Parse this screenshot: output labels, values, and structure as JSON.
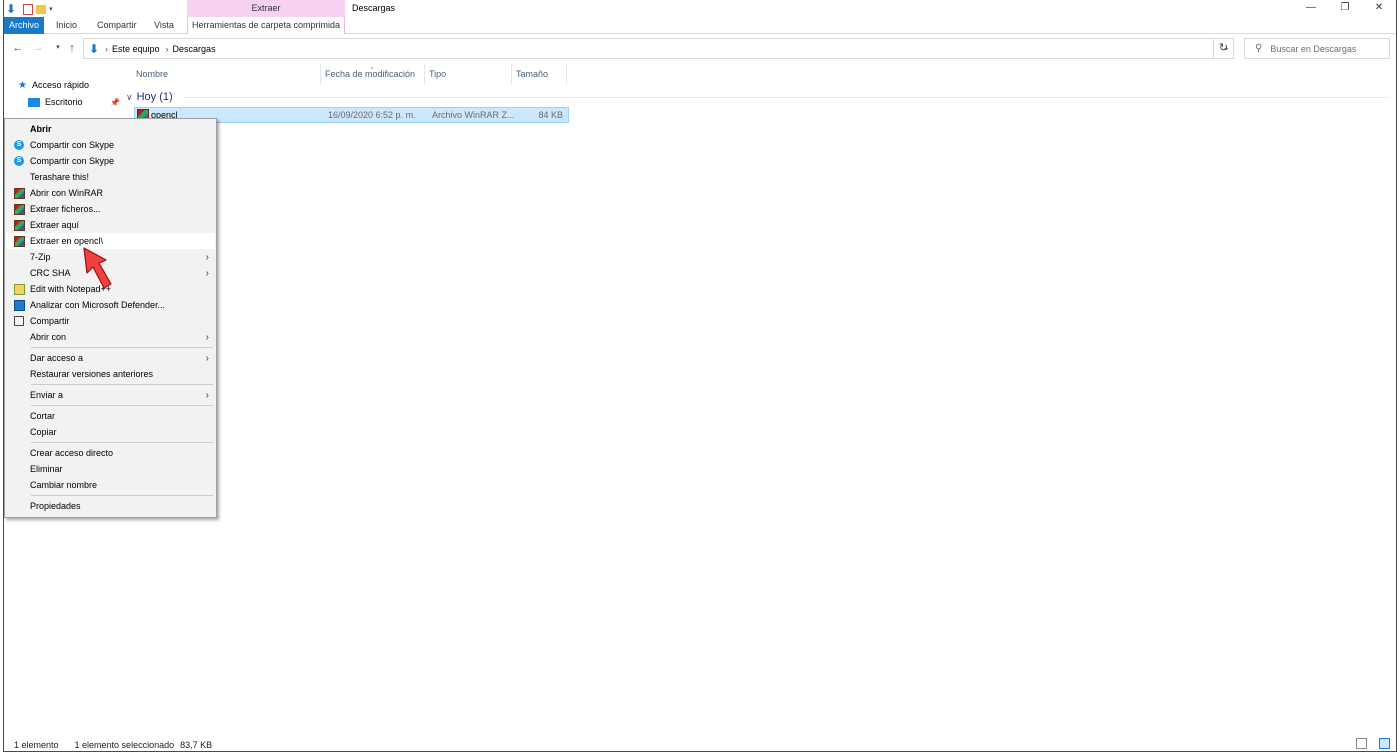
{
  "window": {
    "title": "Descargas",
    "context_tab_group": "Extraer",
    "controls": {
      "minimize": "—",
      "restore": "❐",
      "close": "✕"
    }
  },
  "ribbon": {
    "tabs": [
      "Archivo",
      "Inicio",
      "Compartir",
      "Vista",
      "Herramientas de carpeta comprimida"
    ]
  },
  "address": {
    "crumbs": [
      "Este equipo",
      "Descargas"
    ],
    "search_placeholder": "Buscar en Descargas"
  },
  "navpane": {
    "quick_access": "Acceso rápido",
    "escritorio": "Escritorio"
  },
  "columns": {
    "name": "Nombre",
    "date": "Fecha de modificación",
    "type": "Tipo",
    "size": "Tamaño"
  },
  "group": {
    "label": "Hoy (1)"
  },
  "file": {
    "name": "opencl",
    "date": "16/09/2020 6:52 p. m.",
    "type": "Archivo WinRAR Z...",
    "size": "84 KB"
  },
  "context_menu": {
    "items": [
      {
        "label": "Abrir",
        "icon": "none"
      },
      {
        "label": "Compartir con Skype",
        "icon": "skype-icon"
      },
      {
        "label": "Compartir con Skype",
        "icon": "skype-icon"
      },
      {
        "label": "Terashare this!",
        "icon": "none"
      },
      {
        "label": "Abrir con WinRAR",
        "icon": "winrar-icon"
      },
      {
        "label": "Extraer ficheros...",
        "icon": "winrar-icon"
      },
      {
        "label": "Extraer aquí",
        "icon": "winrar-icon"
      },
      {
        "label": "Extraer en opencl\\",
        "icon": "winrar-icon",
        "hovered": true
      },
      {
        "label": "7-Zip",
        "icon": "none",
        "submenu": true
      },
      {
        "label": "CRC SHA",
        "icon": "none",
        "submenu": true
      },
      {
        "label": "Edit with Notepad++",
        "icon": "notepad-icon"
      },
      {
        "label": "Analizar con Microsoft Defender...",
        "icon": "defender-icon"
      },
      {
        "label": "Compartir",
        "icon": "share-icon"
      },
      {
        "label": "Abrir con",
        "icon": "none",
        "submenu": true
      },
      {
        "label": "Dar acceso a",
        "icon": "none",
        "submenu": true
      },
      {
        "label": "Restaurar versiones anteriores",
        "icon": "none"
      },
      {
        "label": "Enviar a",
        "icon": "none",
        "submenu": true
      },
      {
        "label": "Cortar",
        "icon": "none"
      },
      {
        "label": "Copiar",
        "icon": "none"
      },
      {
        "label": "Crear acceso directo",
        "icon": "none"
      },
      {
        "label": "Eliminar",
        "icon": "none"
      },
      {
        "label": "Cambiar nombre",
        "icon": "none"
      },
      {
        "label": "Propiedades",
        "icon": "none"
      }
    ]
  },
  "status": {
    "count": "1 elemento",
    "selected": "1 elemento seleccionado",
    "size": "83,7 KB"
  },
  "colors": {
    "accent": "#1979ca",
    "selection": "#cce8ff",
    "context_tab": "#f6d2f0",
    "pointer_arrow": "#f04040"
  }
}
